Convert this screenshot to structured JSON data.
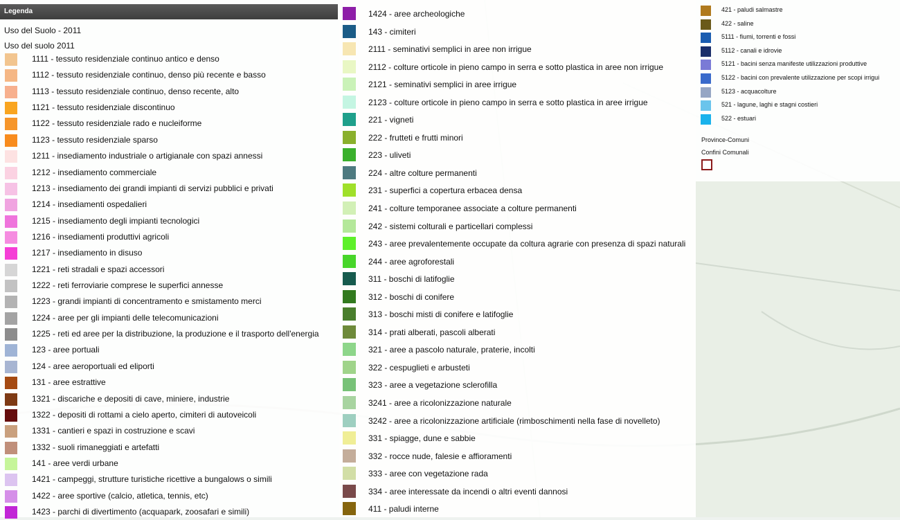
{
  "legend": {
    "header": "Legenda",
    "layer_title": "Uso del Suolo - 2011",
    "sublayer_title": "Uso del suolo 2011",
    "column1": [
      {
        "label": "1111 - tessuto residenziale continuo antico e denso",
        "color": "#f2c58f"
      },
      {
        "label": "1112 - tessuto residenziale continuo, denso più recente e basso",
        "color": "#f5b785"
      },
      {
        "label": "1113 - tessuto residenziale continuo, denso recente, alto",
        "color": "#f7b08e"
      },
      {
        "label": "1121 - tessuto residenziale discontinuo",
        "color": "#f9a520"
      },
      {
        "label": "1122 - tessuto residenziale rado e nucleiforme",
        "color": "#f6962b"
      },
      {
        "label": "1123 - tessuto residenziale sparso",
        "color": "#f88c1e"
      },
      {
        "label": "1211 - insediamento industriale o artigianale con spazi annessi",
        "color": "#fde2e2"
      },
      {
        "label": "1212 - insediamento commerciale",
        "color": "#fbd2e2"
      },
      {
        "label": "1213 - insediamento dei grandi impianti di servizi pubblici e privati",
        "color": "#f6c2e5"
      },
      {
        "label": "1214 - insediamenti ospedalieri",
        "color": "#f0a4e0"
      },
      {
        "label": "1215 - insediamento degli impianti tecnologici",
        "color": "#ef74dc"
      },
      {
        "label": "1216 - insediamenti produttivi agricoli",
        "color": "#f58ce0"
      },
      {
        "label": "1217 - insediamento in disuso",
        "color": "#f53ed6"
      },
      {
        "label": "1221 - reti stradali e spazi accessori",
        "color": "#d6d6d6"
      },
      {
        "label": "1222 - reti ferroviarie comprese le superfici annesse",
        "color": "#c2c2c2"
      },
      {
        "label": "1223 - grandi impianti di concentramento e smistamento merci",
        "color": "#b3b3b3"
      },
      {
        "label": "1224 - aree per gli impianti delle telecomunicazioni",
        "color": "#a3a3a3"
      },
      {
        "label": "1225 - reti ed aree per la distribuzione, la produzione e il trasporto dell'energia",
        "color": "#8c8c8c"
      },
      {
        "label": "123 - aree portuali",
        "color": "#9fb4d6"
      },
      {
        "label": "124 - aree aeroportuali ed eliporti",
        "color": "#a7b5d2"
      },
      {
        "label": "131 - aree estrattive",
        "color": "#a54a12"
      },
      {
        "label": "1321 - discariche e depositi di cave, miniere, industrie",
        "color": "#7e3a14"
      },
      {
        "label": "1322 - depositi di rottami a cielo aperto, cimiteri di autoveicoli",
        "color": "#650d0d"
      },
      {
        "label": "1331 - cantieri e spazi in costruzione e scavi",
        "color": "#c9a07e"
      },
      {
        "label": "1332 - suoli rimaneggiati e artefatti",
        "color": "#c08f7a"
      },
      {
        "label": "141 - aree verdi urbane",
        "color": "#c6f59a"
      },
      {
        "label": "1421 - campeggi, strutture turistiche ricettive a bungalows o simili",
        "color": "#dcc4f0"
      },
      {
        "label": "1422 - aree sportive (calcio, atletica, tennis, etc)",
        "color": "#d58fe8"
      },
      {
        "label": "1423 - parchi di divertimento (acquapark, zoosafari e simili)",
        "color": "#c126d6"
      }
    ],
    "column2": [
      {
        "label": "1424 - aree archeologiche",
        "color": "#8e1ea8"
      },
      {
        "label": "143 - cimiteri",
        "color": "#1b5c87"
      },
      {
        "label": "2111 - seminativi semplici in aree non irrigue",
        "color": "#f7e6b2"
      },
      {
        "label": "2112 - colture orticole in pieno campo in serra e sotto plastica in aree non irrigue",
        "color": "#e9f7c4"
      },
      {
        "label": "2121 - seminativi semplici in aree irrigue",
        "color": "#caf2b8"
      },
      {
        "label": "2123 - colture orticole in pieno campo in serra e sotto plastica in aree irrigue",
        "color": "#c4f5e2"
      },
      {
        "label": "221 - vigneti",
        "color": "#1fa08b"
      },
      {
        "label": "222 - frutteti e frutti minori",
        "color": "#8ab02c"
      },
      {
        "label": "223 - uliveti",
        "color": "#3ab02c"
      },
      {
        "label": "224 - altre colture permanenti",
        "color": "#4e7a80"
      },
      {
        "label": "231 - superfici a copertura erbacea densa",
        "color": "#a0e02a"
      },
      {
        "label": "241 - colture temporanee associate a colture permanenti",
        "color": "#d2f0b6"
      },
      {
        "label": "242 - sistemi colturali e particellari complessi",
        "color": "#b4e89a"
      },
      {
        "label": "243 - aree prevalentemente occupate da coltura agrarie con presenza di spazi naturali",
        "color": "#5ef02a"
      },
      {
        "label": "244 - aree agroforestali",
        "color": "#48d62a"
      },
      {
        "label": "311 - boschi di latifoglie",
        "color": "#175b4e"
      },
      {
        "label": "312 - boschi di conifere",
        "color": "#327a1e"
      },
      {
        "label": "313 - boschi misti di conifere e latifoglie",
        "color": "#497e2c"
      },
      {
        "label": "314 - prati alberati, pascoli alberati",
        "color": "#6e8a3a"
      },
      {
        "label": "321 - aree a pascolo naturale, praterie, incolti",
        "color": "#8ed68a"
      },
      {
        "label": "322 - cespuglieti e arbusteti",
        "color": "#a0d48a"
      },
      {
        "label": "323 - aree a vegetazione sclerofilla",
        "color": "#78c278"
      },
      {
        "label": "3241 - aree a ricolonizzazione naturale",
        "color": "#a8d4a0"
      },
      {
        "label": "3242 - aree a ricolonizzazione artificiale (rimboschimenti nella fase di novelleto)",
        "color": "#9ecfc0"
      },
      {
        "label": "331 - spiagge, dune e sabbie",
        "color": "#f0ee96"
      },
      {
        "label": "332 - rocce nude, falesie e affioramenti",
        "color": "#c4ad9a"
      },
      {
        "label": "333 - aree con vegetazione rada",
        "color": "#d2dea6"
      },
      {
        "label": "334 - aree interessate da incendi o altri eventi dannosi",
        "color": "#7a4a4a"
      },
      {
        "label": "411 - paludi interne",
        "color": "#86650e"
      }
    ],
    "column3": [
      {
        "label": "421 - paludi salmastre",
        "color": "#b07a1e"
      },
      {
        "label": "422 - saline",
        "color": "#6a5a1a"
      },
      {
        "label": "5111 - fiumi, torrenti e fossi",
        "color": "#1a5cb0"
      },
      {
        "label": "5112 - canali e idrovie",
        "color": "#1a2e6a"
      },
      {
        "label": "5121 - bacini senza manifeste utilizzazioni produttive",
        "color": "#7a7ad6"
      },
      {
        "label": "5122 - bacini con prevalente utilizzazione per scopi irrigui",
        "color": "#3a6acb"
      },
      {
        "label": "5123 - acquacolture",
        "color": "#96a6c4"
      },
      {
        "label": "521 - lagune, laghi e stagni costieri",
        "color": "#6ac4ec"
      },
      {
        "label": "522 - estuari",
        "color": "#1ab2ec"
      }
    ],
    "province_title": "Province-Comuni",
    "confini_title": "Confini Comunali",
    "confini_color": "#8b1a1a"
  }
}
